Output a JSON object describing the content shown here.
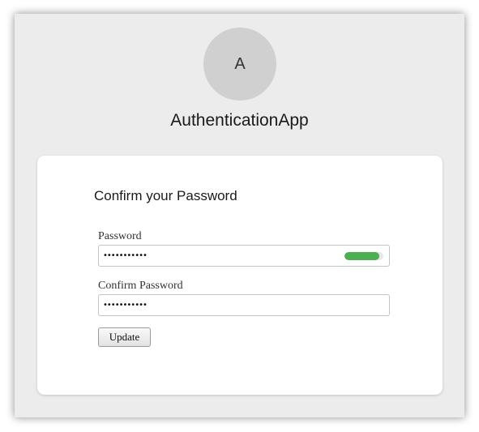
{
  "avatar": {
    "initial": "A"
  },
  "app": {
    "title": "AuthenticationApp"
  },
  "form": {
    "title": "Confirm your Password",
    "password": {
      "label": "Password",
      "value": "•••••••••••",
      "strength": 0.9,
      "strength_color": "#4caf50"
    },
    "confirm_password": {
      "label": "Confirm Password",
      "value": "•••••••••••"
    },
    "update_label": "Update"
  }
}
